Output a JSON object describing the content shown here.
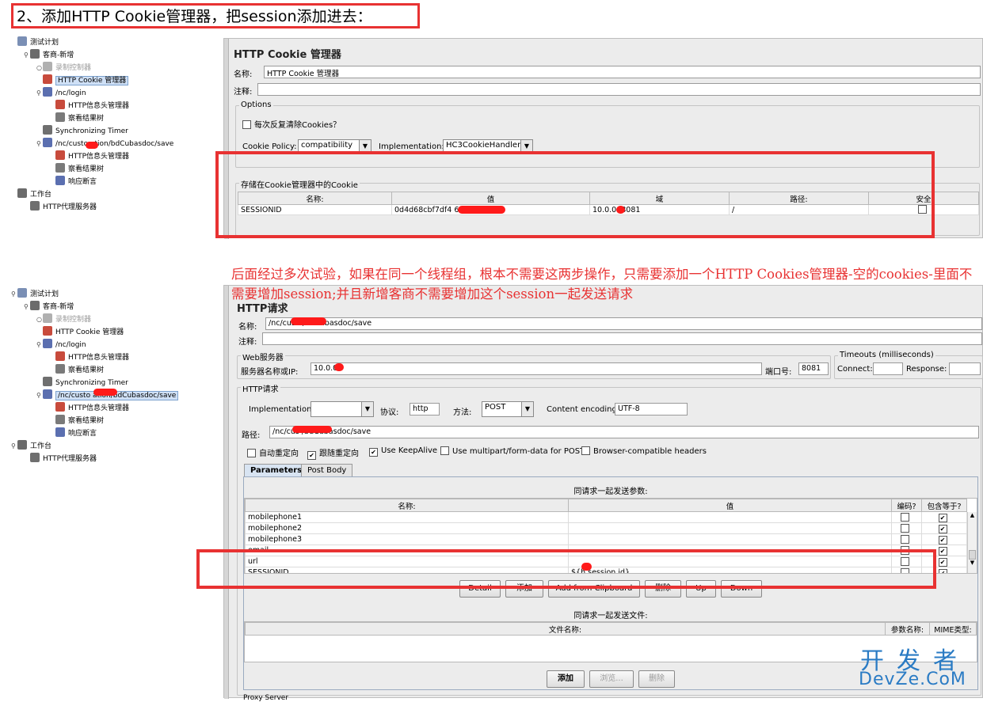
{
  "heading": "2、添加HTTP Cookie管理器，把session添加进去：",
  "tree1": [
    {
      "label": "测试计划",
      "indent": 0,
      "icon": "flask-icon",
      "color": "#7a8fb5",
      "toggle": ""
    },
    {
      "label": "客商-新增",
      "indent": 1,
      "icon": "thread-group-icon",
      "color": "#6b6b6b",
      "toggle": "⚲"
    },
    {
      "label": "录制控制器",
      "indent": 2,
      "icon": "recording-controller-icon",
      "color": "#b0b0b0",
      "toggle": "○",
      "dim": true
    },
    {
      "label": "HTTP Cookie 管理器",
      "indent": 2,
      "icon": "cookie-manager-icon",
      "color": "#c84b3c",
      "toggle": "",
      "selected": true
    },
    {
      "label": "/nc/login",
      "indent": 2,
      "icon": "sampler-icon",
      "color": "#5b6fb0",
      "toggle": "⚲"
    },
    {
      "label": "HTTP信息头管理器",
      "indent": 3,
      "icon": "header-manager-icon",
      "color": "#c84b3c",
      "toggle": ""
    },
    {
      "label": "察看结果树",
      "indent": 3,
      "icon": "results-tree-icon",
      "color": "#7a7a7a",
      "toggle": ""
    },
    {
      "label": "Synchronizing Timer",
      "indent": 2,
      "icon": "timer-icon",
      "color": "#6f6f6f",
      "toggle": ""
    },
    {
      "label": "/nc/custo        ation/bdCubasdoc/save",
      "indent": 2,
      "icon": "sampler-icon",
      "color": "#5b6fb0",
      "toggle": "⚲"
    },
    {
      "label": "HTTP信息头管理器",
      "indent": 3,
      "icon": "header-manager-icon",
      "color": "#c84b3c",
      "toggle": ""
    },
    {
      "label": "察看结果树",
      "indent": 3,
      "icon": "results-tree-icon",
      "color": "#7a7a7a",
      "toggle": ""
    },
    {
      "label": "响应断言",
      "indent": 3,
      "icon": "assertion-icon",
      "color": "#5b6fb0",
      "toggle": ""
    },
    {
      "label": "工作台",
      "indent": 0,
      "icon": "workbench-icon",
      "color": "#6b6b6b",
      "toggle": ""
    },
    {
      "label": "HTTP代理服务器",
      "indent": 1,
      "icon": "proxy-icon",
      "color": "#6f6f6f",
      "toggle": ""
    }
  ],
  "tree2": [
    {
      "label": "测试计划",
      "indent": 0,
      "icon": "flask-icon",
      "color": "#7a8fb5",
      "toggle": "⚲"
    },
    {
      "label": "客商-新增",
      "indent": 1,
      "icon": "thread-group-icon",
      "color": "#6b6b6b",
      "toggle": "⚲"
    },
    {
      "label": "录制控制器",
      "indent": 2,
      "icon": "recording-controller-icon",
      "color": "#b0b0b0",
      "toggle": "○",
      "dim": true
    },
    {
      "label": "HTTP Cookie 管理器",
      "indent": 2,
      "icon": "cookie-manager-icon",
      "color": "#c84b3c",
      "toggle": ""
    },
    {
      "label": "/nc/login",
      "indent": 2,
      "icon": "sampler-icon",
      "color": "#5b6fb0",
      "toggle": "⚲"
    },
    {
      "label": "HTTP信息头管理器",
      "indent": 3,
      "icon": "header-manager-icon",
      "color": "#c84b3c",
      "toggle": ""
    },
    {
      "label": "察看结果树",
      "indent": 3,
      "icon": "results-tree-icon",
      "color": "#7a7a7a",
      "toggle": ""
    },
    {
      "label": "Synchronizing Timer",
      "indent": 2,
      "icon": "timer-icon",
      "color": "#6f6f6f",
      "toggle": ""
    },
    {
      "label": "/nc/custo        ation/bdCubasdoc/save",
      "indent": 2,
      "icon": "sampler-icon",
      "color": "#5b6fb0",
      "toggle": "⚲",
      "selected": true
    },
    {
      "label": "HTTP信息头管理器",
      "indent": 3,
      "icon": "header-manager-icon",
      "color": "#c84b3c",
      "toggle": ""
    },
    {
      "label": "察看结果树",
      "indent": 3,
      "icon": "results-tree-icon",
      "color": "#7a7a7a",
      "toggle": ""
    },
    {
      "label": "响应断言",
      "indent": 3,
      "icon": "assertion-icon",
      "color": "#5b6fb0",
      "toggle": ""
    },
    {
      "label": "工作台",
      "indent": 0,
      "icon": "workbench-icon",
      "color": "#6b6b6b",
      "toggle": "⚲"
    },
    {
      "label": "HTTP代理服务器",
      "indent": 1,
      "icon": "proxy-icon",
      "color": "#6f6f6f",
      "toggle": ""
    }
  ],
  "cookie": {
    "title": "HTTP Cookie 管理器",
    "name_label": "名称:",
    "name_value": "HTTP Cookie 管理器",
    "comment_label": "注释:",
    "options_label": "Options",
    "clear_each": "每次反复清除Cookies？",
    "policy_label": "Cookie Policy:",
    "policy_value": "compatibility",
    "impl_label": "Implementation:",
    "impl_value": "HC3CookieHandler",
    "stored_label": "存储在Cookie管理器中的Cookie",
    "columns": [
      "名称:",
      "值",
      "域",
      "路径:",
      "安全"
    ],
    "row": {
      "name": "SESSIONID",
      "value": "0d4d68cbf7df4                   6cc17",
      "domain": "10.0.0.    8081",
      "path": "/"
    }
  },
  "note": "后面经过多次试验，如果在同一个线程组，根本不需要这两步操作，只需要添加一个HTTP Cookies管理器-空的cookies-里面不需要增加session;并且新增客商不需要增加这个session一起发送请求",
  "http": {
    "title": "HTTP请求",
    "name_label": "名称:",
    "name_value": "/nc/cus               n/bdCubasdoc/save",
    "comment_label": "注释:",
    "web_server_label": "Web服务器",
    "server_label": "服务器名称或IP:",
    "server_value": "10.0.0.",
    "port_label": "端口号:",
    "port_value": "8081",
    "timeouts_label": "Timeouts (milliseconds)",
    "connect_label": "Connect:",
    "response_label": "Response:",
    "request_label": "HTTP请求",
    "impl_label": "Implementation:",
    "protocol_label": "协议:",
    "protocol_value": "http",
    "method_label": "方法:",
    "method_value": "POST",
    "encoding_label": "Content encoding:",
    "encoding_value": "UTF-8",
    "path_label": "路径:",
    "path_value": "/nc/cus              /bdCubasdoc/save",
    "checks": [
      {
        "label": "自动重定向",
        "checked": false
      },
      {
        "label": "跟随重定向",
        "checked": true
      },
      {
        "label": "Use KeepAlive",
        "checked": true
      },
      {
        "label": "Use multipart/form-data for POST",
        "checked": false
      },
      {
        "label": "Browser-compatible headers",
        "checked": false
      }
    ],
    "tabs": [
      "Parameters",
      "Post Body"
    ],
    "params_title": "同请求一起发送参数:",
    "param_columns": [
      "名称:",
      "值",
      "编码?",
      "包含等于?"
    ],
    "params": [
      {
        "name": "mobilephone1",
        "value": "",
        "encode": false,
        "include": true
      },
      {
        "name": "mobilephone2",
        "value": "",
        "encode": false,
        "include": true
      },
      {
        "name": "mobilephone3",
        "value": "",
        "encode": false,
        "include": true
      },
      {
        "name": "email",
        "value": "",
        "encode": false,
        "include": true
      },
      {
        "name": "url",
        "value": "",
        "encode": false,
        "include": true
      },
      {
        "name": "SESSIONID",
        "value": "${h      session.id}",
        "encode": false,
        "include": true
      }
    ],
    "param_buttons": [
      "Detail",
      "添加",
      "Add from Clipboard",
      "删除",
      "Up",
      "Down"
    ],
    "files_title": "同请求一起发送文件:",
    "file_columns": [
      "文件名称:",
      "参数名称:",
      "MIME类型:"
    ],
    "file_buttons": [
      "添加",
      "浏览...",
      "删除"
    ],
    "proxy_label": "Proxy Server"
  },
  "watermark": {
    "line1": "开发者",
    "line2": "DevZe.CoM"
  }
}
